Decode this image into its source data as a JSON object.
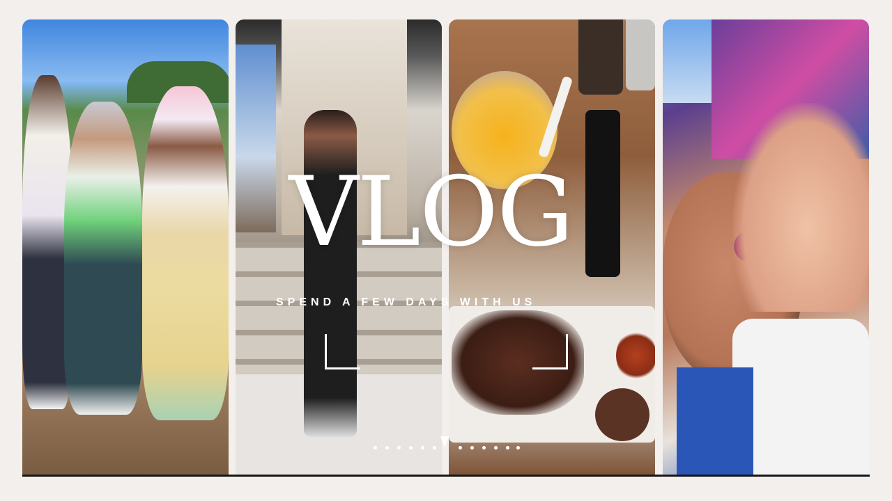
{
  "thumbnail": {
    "title": "VLOG",
    "subtitle": "SPEND A FEW DAYS WITH US"
  },
  "panels": [
    {
      "name": "kids-at-color-run",
      "icon": "photo-icon"
    },
    {
      "name": "woman-on-steps",
      "icon": "photo-icon"
    },
    {
      "name": "drink-and-food-table",
      "icon": "photo-icon"
    },
    {
      "name": "child-with-face-paint",
      "icon": "photo-icon"
    }
  ],
  "colors": {
    "background": "#f3efec",
    "text": "#ffffff"
  }
}
